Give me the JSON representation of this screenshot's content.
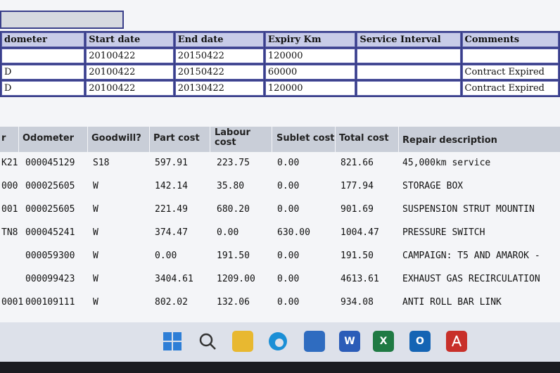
{
  "contract_table": {
    "headers": [
      "dometer",
      "Start date",
      "End date",
      "Expiry Km",
      "Service Interval",
      "Comments"
    ],
    "rows": [
      [
        "",
        "20100422",
        "20150422",
        "120000",
        "",
        ""
      ],
      [
        "D",
        "20100422",
        "20150422",
        "60000",
        "",
        "Contract Expired"
      ],
      [
        "D",
        "20100422",
        "20130422",
        "120000",
        "",
        "Contract Expired"
      ]
    ]
  },
  "repair_table": {
    "headers": [
      "r",
      "Odometer",
      "Goodwill?",
      "Part cost",
      "Labour cost",
      "Sublet cost",
      "Total cost",
      "Repair description"
    ],
    "rows": [
      [
        "K21",
        "000045129",
        "S18",
        "597.91",
        "223.75",
        "0.00",
        "821.66",
        "45,000km service"
      ],
      [
        "000",
        "000025605",
        "W",
        "142.14",
        "35.80",
        "0.00",
        "177.94",
        "STORAGE BOX"
      ],
      [
        "001",
        "000025605",
        "W",
        "221.49",
        "680.20",
        "0.00",
        "901.69",
        "SUSPENSION STRUT MOUNTIN"
      ],
      [
        "TN8",
        "000045241",
        "W",
        "374.47",
        "0.00",
        "630.00",
        "1004.47",
        "PRESSURE SWITCH"
      ],
      [
        "",
        "000059300",
        "W",
        "0.00",
        "191.50",
        "0.00",
        "191.50",
        "CAMPAIGN: T5 AND AMAROK -"
      ],
      [
        "",
        "000099423",
        "W",
        "3404.61",
        "1209.00",
        "0.00",
        "4613.61",
        "EXHAUST GAS RECIRCULATION"
      ],
      [
        "0001",
        "000109111",
        "W",
        "802.02",
        "132.06",
        "0.00",
        "934.08",
        "ANTI ROLL BAR LINK"
      ]
    ]
  },
  "taskbar": {
    "icons": [
      "windows-start-icon",
      "search-icon",
      "file-explorer-icon",
      "edge-icon",
      "store-icon",
      "word-icon",
      "excel-icon",
      "outlook-icon",
      "acrobat-icon"
    ],
    "labels": {
      "word": "W",
      "excel": "X",
      "outlook": "O"
    }
  },
  "colors": {
    "header_bg": "#c9ced8",
    "table_border": "#3a3f8a",
    "accent_word": "#2b5cb8",
    "accent_excel": "#1f7a43",
    "accent_acrobat": "#c8302a"
  }
}
